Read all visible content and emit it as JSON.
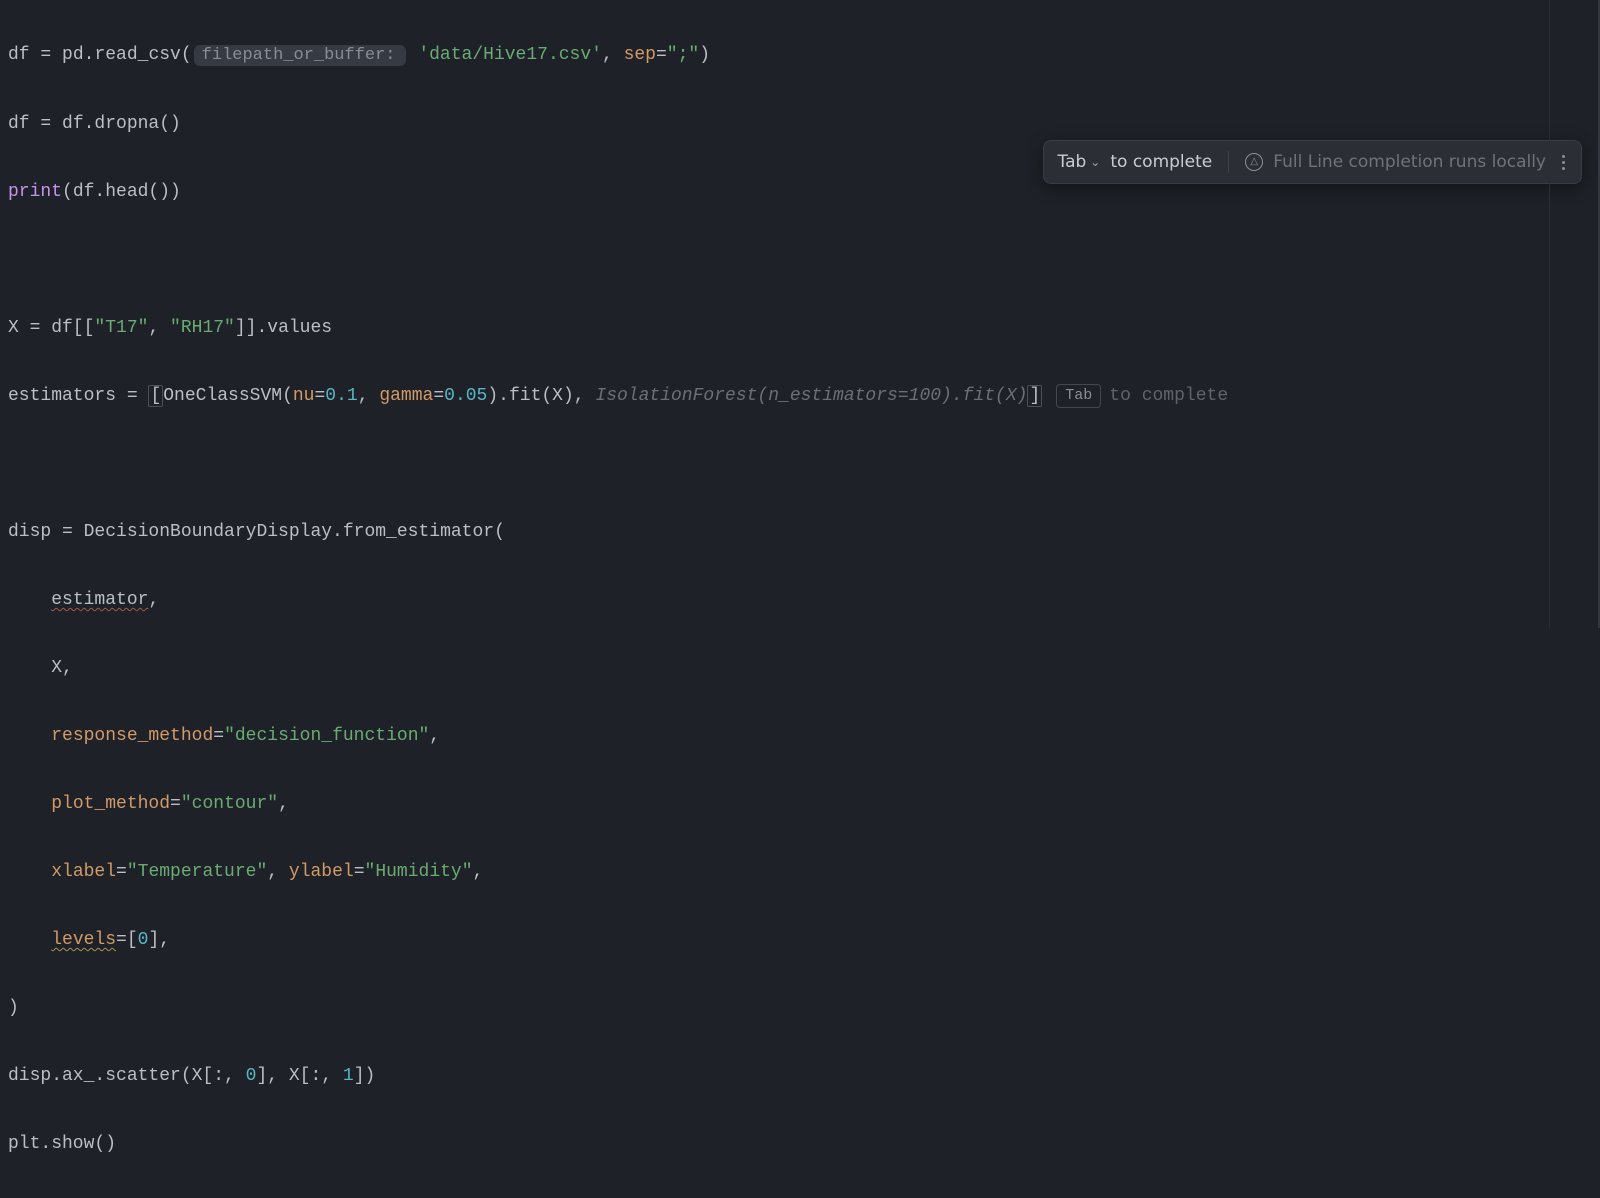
{
  "code": {
    "l1": {
      "var": "df",
      "eq": " = ",
      "mod": "pd",
      "dot": ".",
      "fn": "read_csv",
      "open": "(",
      "hint": "filepath_or_buffer:",
      "path": "'data/Hive17.csv'",
      "comma": ", ",
      "sep_kw": "sep",
      "sep_eq": "=",
      "sep_val": "\";\"",
      "close": ")"
    },
    "l2": {
      "text_a": "df",
      "text_b": " = df.dropna()"
    },
    "l3": {
      "builtin": "print",
      "rest": "(df.head())"
    },
    "l5": {
      "lhs": "X = df[[",
      "s1": "\"T17\"",
      "c1": ", ",
      "s2": "\"RH17\"",
      "rhs": "]].values"
    },
    "l6": {
      "lhs": "estimators = ",
      "lbr": "[",
      "cls1": "OneClassSVM(",
      "nu_kw": "nu",
      "nu_eq": "=",
      "nu_val": "0.1",
      "c1": ", ",
      "ga_kw": "gamma",
      "ga_eq": "=",
      "ga_val": "0.05",
      "mid": ").fit(X), ",
      "ghost": "IsolationForest(n_estimators=100).fit(X)",
      "rbr": "]",
      "tab_label": "Tab",
      "tab_hint": "to complete"
    },
    "l8": {
      "text": "disp = DecisionBoundaryDisplay.from_estimator("
    },
    "l9": {
      "indent": "    ",
      "name": "estimator",
      "comma": ","
    },
    "l10": {
      "text": "    X,"
    },
    "l11": {
      "indent": "    ",
      "kw": "response_method",
      "eq": "=",
      "val": "\"decision_function\"",
      "comma": ","
    },
    "l12": {
      "indent": "    ",
      "kw": "plot_method",
      "eq": "=",
      "val": "\"contour\"",
      "comma": ","
    },
    "l13": {
      "indent": "    ",
      "kw1": "xlabel",
      "eq1": "=",
      "v1": "\"Temperature\"",
      "c": ", ",
      "kw2": "ylabel",
      "eq2": "=",
      "v2": "\"Humidity\"",
      "comma": ","
    },
    "l14": {
      "indent": "    ",
      "kw": "levels",
      "eq": "=",
      "lb": "[",
      "num": "0",
      "rb": "]",
      "comma": ","
    },
    "l15": {
      "text": ")"
    },
    "l16": {
      "a": "disp.ax_.scatter(X[:, ",
      "n1": "0",
      "b": "], X[:, ",
      "n2": "1",
      "c": "])"
    },
    "l17": {
      "text": "plt.show()"
    }
  },
  "popup": {
    "tab": "Tab",
    "complete": "to complete",
    "ai_glyph": "△",
    "full_line": "Full Line completion runs locally"
  }
}
